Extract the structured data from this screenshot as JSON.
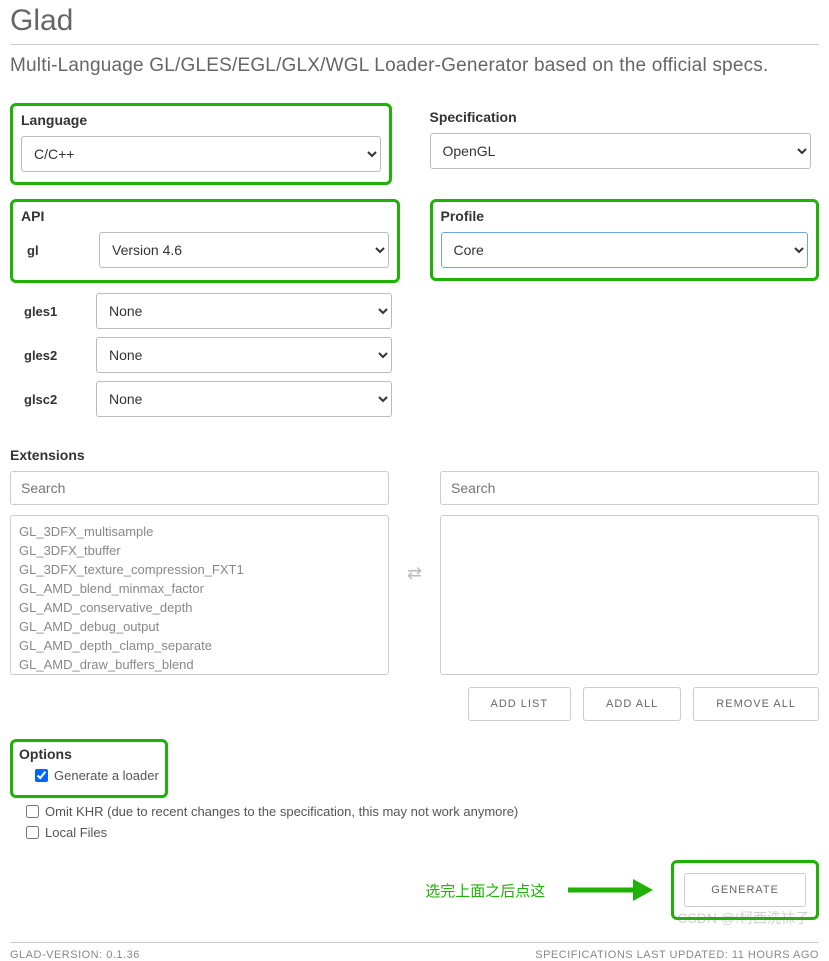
{
  "header": {
    "title": "Glad"
  },
  "subtitle": "Multi-Language GL/GLES/EGL/GLX/WGL Loader-Generator based on the official specs.",
  "language": {
    "label": "Language",
    "value": "C/C++"
  },
  "specification": {
    "label": "Specification",
    "value": "OpenGL"
  },
  "api": {
    "label": "API",
    "rows": [
      {
        "name": "gl",
        "value": "Version 4.6"
      },
      {
        "name": "gles1",
        "value": "None"
      },
      {
        "name": "gles2",
        "value": "None"
      },
      {
        "name": "glsc2",
        "value": "None"
      }
    ]
  },
  "profile": {
    "label": "Profile",
    "value": "Core"
  },
  "extensions": {
    "label": "Extensions",
    "search_placeholder": "Search",
    "available": [
      "GL_3DFX_multisample",
      "GL_3DFX_tbuffer",
      "GL_3DFX_texture_compression_FXT1",
      "GL_AMD_blend_minmax_factor",
      "GL_AMD_conservative_depth",
      "GL_AMD_debug_output",
      "GL_AMD_depth_clamp_separate",
      "GL_AMD_draw_buffers_blend"
    ],
    "buttons": {
      "add_list": "ADD LIST",
      "add_all": "ADD ALL",
      "remove_all": "REMOVE ALL"
    }
  },
  "options": {
    "label": "Options",
    "generate_loader": {
      "label": "Generate a loader",
      "checked": true
    },
    "omit_khr": {
      "label": "Omit KHR (due to recent changes to the specification, this may not work anymore)",
      "checked": false
    },
    "local_files": {
      "label": "Local Files",
      "checked": false
    }
  },
  "annotation": "选完上面之后点这",
  "generate_button": "GENERATE",
  "footer": {
    "left": "GLAD-VERSION: 0.1.36",
    "right": "SPECIFICATIONS LAST UPDATED: 11 HOURS AGO"
  },
  "watermark": "CSDN @!柯西洗袜子"
}
